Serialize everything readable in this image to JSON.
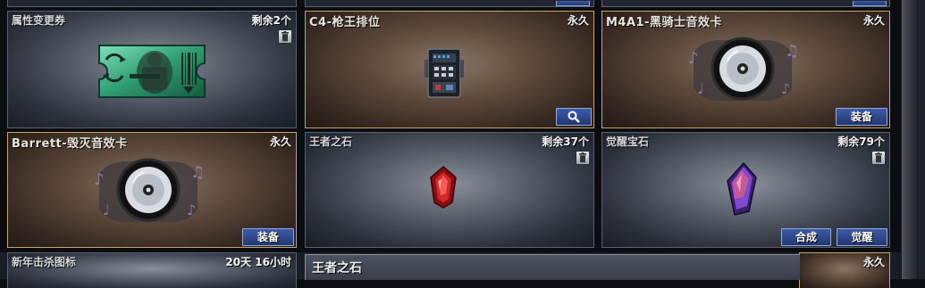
{
  "cards": [
    {
      "name": "属性变更券",
      "status": "剩余2个"
    },
    {
      "name": "C4-枪王排位",
      "status": "永久"
    },
    {
      "name": "M4A1-黑骑士音效卡",
      "status": "永久"
    },
    {
      "name": "Barrett-毁灭音效卡",
      "status": "永久"
    },
    {
      "name": "王者之石",
      "status": "剩余37个"
    },
    {
      "name": "觉醒宝石",
      "status": "剩余79个"
    },
    {
      "name": "新年击杀图标",
      "status": "20天 16小时"
    },
    {
      "name": "",
      "status": "永久"
    }
  ],
  "buttons": {
    "equip": "装备",
    "combine": "合成",
    "awaken": "觉醒"
  },
  "popup": {
    "title": "王者之石"
  },
  "icons": {
    "trash": "trash-icon",
    "search": "magnifier-icon",
    "ticket": "ticket-icon",
    "c4": "c4-bomb-icon",
    "sound_card": "sound-card-disc-icon",
    "king_stone": "red-gem-icon",
    "awaken_gem": "purple-crystal-icon"
  }
}
